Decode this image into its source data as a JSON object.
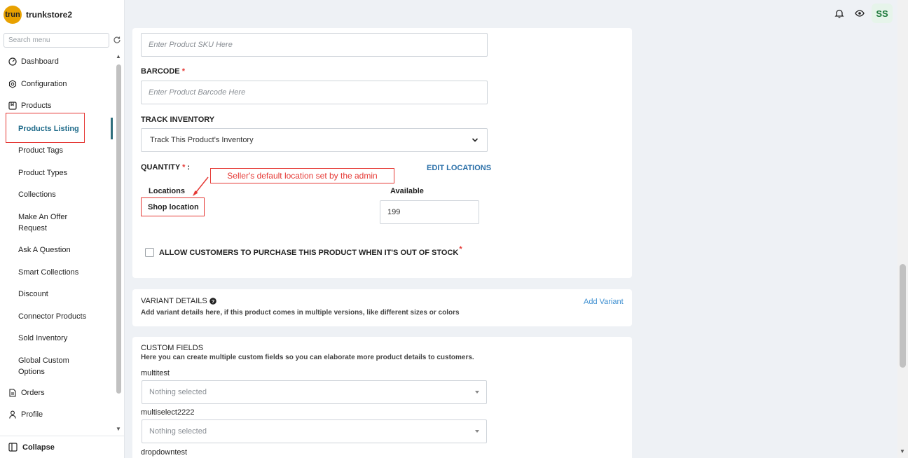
{
  "brand": {
    "logo_text": "trun",
    "name": "trunkstore2"
  },
  "sidebar": {
    "search_placeholder": "Search menu",
    "items": [
      {
        "label": "Dashboard",
        "icon": "dashboard-icon"
      },
      {
        "label": "Configuration",
        "icon": "gear-icon"
      },
      {
        "label": "Products",
        "icon": "bookmark-icon"
      },
      {
        "label": "Products Listing",
        "active": true
      },
      {
        "label": "Product Tags"
      },
      {
        "label": "Product Types"
      },
      {
        "label": "Collections"
      },
      {
        "label": "Make An Offer Request"
      },
      {
        "label": "Ask A Question"
      },
      {
        "label": "Smart Collections"
      },
      {
        "label": "Discount"
      },
      {
        "label": "Connector Products"
      },
      {
        "label": "Sold Inventory"
      },
      {
        "label": "Global Custom Options"
      },
      {
        "label": "Orders",
        "icon": "document-icon"
      },
      {
        "label": "Profile",
        "icon": "user-icon"
      }
    ],
    "collapse_label": "Collapse"
  },
  "header": {
    "avatar_initials": "SS"
  },
  "inventory": {
    "sku_placeholder": "Enter Product SKU Here",
    "barcode_label": "BARCODE",
    "barcode_required": "*",
    "barcode_placeholder": "Enter Product Barcode Here",
    "track_label": "TRACK INVENTORY",
    "track_value": "Track This Product's Inventory",
    "quantity_label": "QUANTITY",
    "quantity_required": "*",
    "quantity_suffix": " :",
    "edit_locations": "EDIT LOCATIONS",
    "annotation": "Seller's default location set by the admin",
    "locations_header": "Locations",
    "available_header": "Available",
    "location_name": "Shop location",
    "available_value": "199",
    "oos_label": "ALLOW CUSTOMERS TO PURCHASE THIS PRODUCT WHEN IT'S OUT OF STOCK",
    "oos_required": "*"
  },
  "variants": {
    "title": "VARIANT DETAILS",
    "description": "Add variant details here, if this product comes in multiple versions, like different sizes or colors",
    "add_label": "Add Variant"
  },
  "custom_fields": {
    "title": "CUSTOM FIELDS",
    "description": "Here you can create multiple custom fields so you can elaborate more product details to customers.",
    "fields": [
      {
        "label": "multitest",
        "value": "Nothing selected"
      },
      {
        "label": "multiselect2222",
        "value": "Nothing selected"
      },
      {
        "label": "dropdowntest"
      }
    ]
  },
  "colors": {
    "accent": "#2a6fa8",
    "annotation": "#e53935",
    "active_nav": "#1f6b8a"
  }
}
